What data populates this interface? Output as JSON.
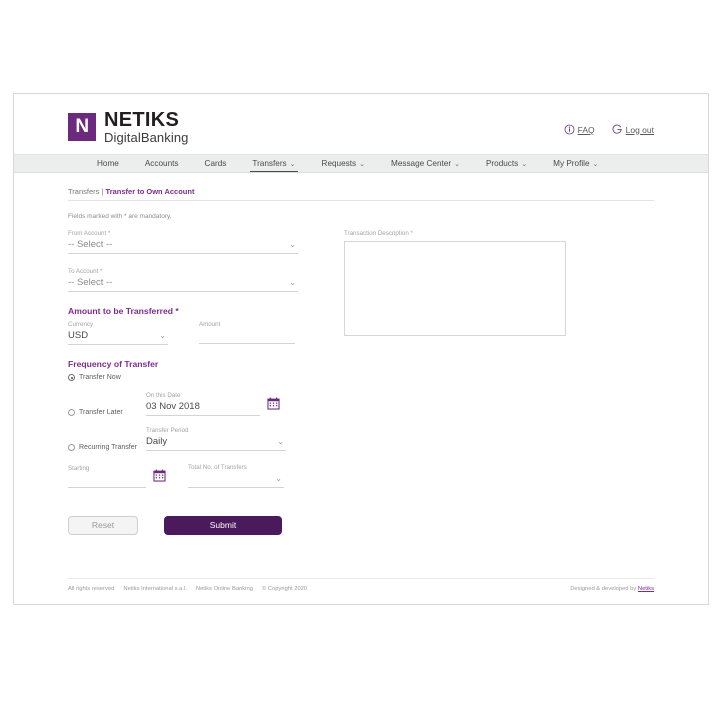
{
  "brand": {
    "mark_letter": "N",
    "title": "NETIKS",
    "subtitle": "DigitalBanking",
    "purple": "#6B2A7E",
    "submit_purple": "#4A1A5C",
    "accent": "#7B2D8E"
  },
  "header": {
    "links": [
      {
        "label": "FAQ",
        "icon": "info-icon"
      },
      {
        "label": "Log out",
        "icon": "power-icon"
      }
    ]
  },
  "nav": {
    "items": [
      {
        "label": "Home",
        "caret": false,
        "active": false
      },
      {
        "label": "Accounts",
        "caret": false,
        "active": false
      },
      {
        "label": "Cards",
        "caret": false,
        "active": false
      },
      {
        "label": "Transfers",
        "caret": true,
        "active": true
      },
      {
        "label": "Requests",
        "caret": true,
        "active": false
      },
      {
        "label": "Message Center",
        "caret": true,
        "active": false
      },
      {
        "label": "Products",
        "caret": true,
        "active": false
      },
      {
        "label": "My Profile",
        "caret": true,
        "active": false
      }
    ],
    "caret_glyph": "⌄"
  },
  "breadcrumb": {
    "parent": "Transfers",
    "separator": "|",
    "current": "Transfer to Own Account"
  },
  "form": {
    "mandatory_note": "Fields marked with * are mandatory.",
    "from_account": {
      "label": "From Account *",
      "value": "-- Select --"
    },
    "to_account": {
      "label": "To Account *",
      "value": "-- Select --"
    },
    "amount_section_title": "Amount to be Transferred *",
    "currency": {
      "label": "Currency",
      "value": "USD"
    },
    "amount": {
      "label": "Amount",
      "value": ""
    },
    "frequency_section_title": "Frequency of Transfer",
    "transfer_now": {
      "label": "Transfer Now",
      "selected": true
    },
    "transfer_later": {
      "label": "Transfer Later",
      "selected": false
    },
    "on_this_date": {
      "label": "On this Date",
      "value": "03 Nov 2018"
    },
    "recurring_transfer": {
      "label": "Recurring Transfer",
      "selected": false
    },
    "transfer_period": {
      "label": "Transfer Period",
      "value": "Daily"
    },
    "starting": {
      "label": "Starting",
      "value": ""
    },
    "total_transfers": {
      "label": "Total No. of Transfers",
      "value": ""
    },
    "transaction_description": {
      "label": "Transaction Description *",
      "value": ""
    }
  },
  "buttons": {
    "reset": "Reset",
    "submit": "Submit"
  },
  "footer": {
    "left": [
      "All rights reserved",
      "Netiks International s.a.l.",
      "Netiks Online Banking",
      "© Copyright 2020"
    ],
    "right_prefix": "Designed & developed by",
    "right_brand": "Netiks"
  }
}
